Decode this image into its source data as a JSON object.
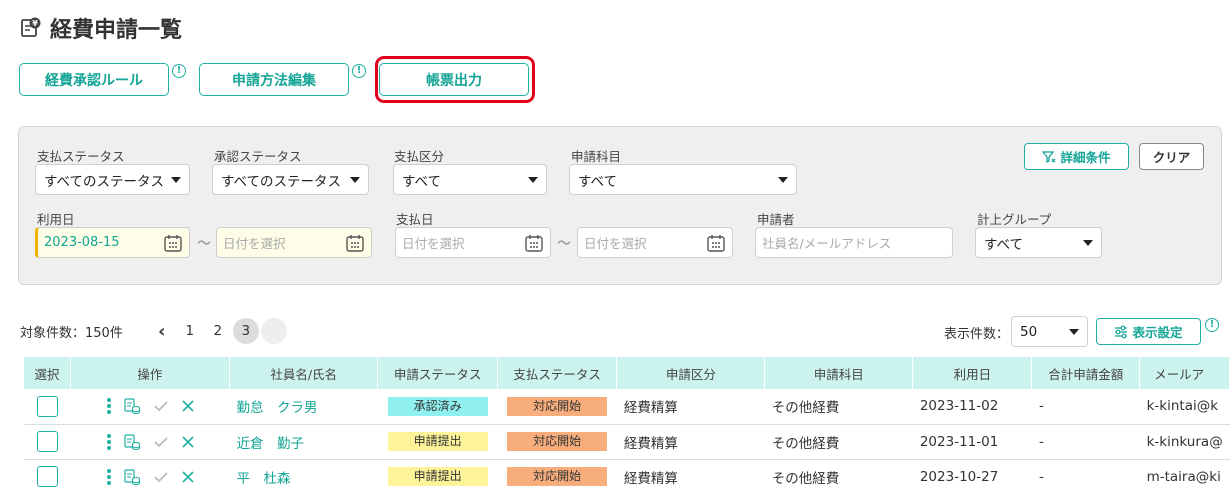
{
  "page": {
    "title": "経費申請一覧"
  },
  "toolbar": {
    "approval_rule": "経費承認ルール",
    "application_edit": "申請方法編集",
    "report_output": "帳票出力",
    "info_glyph": "!"
  },
  "filters": {
    "payment_status": {
      "label": "支払ステータス",
      "value": "すべてのステータス"
    },
    "approval_status": {
      "label": "承認ステータス",
      "value": "すべてのステータス"
    },
    "payment_type": {
      "label": "支払区分",
      "value": "すべて"
    },
    "expense_item": {
      "label": "申請科目",
      "value": "すべて"
    },
    "use_date": {
      "label": "利用日",
      "from": "2023-08-15",
      "to_placeholder": "日付を選択"
    },
    "payment_date": {
      "label": "支払日",
      "from_placeholder": "日付を選択",
      "to_placeholder": "日付を選択"
    },
    "applicant": {
      "label": "申請者",
      "placeholder": "社員名/メールアドレス"
    },
    "group": {
      "label": "計上グループ",
      "value": "すべて"
    },
    "tilde": "〜",
    "detail_button": "詳細条件",
    "clear_button": "クリア"
  },
  "pager": {
    "count_text": "対象件数：150件",
    "prev": "‹",
    "pages": [
      "1",
      "2",
      "3"
    ],
    "current": "3"
  },
  "display": {
    "count_label": "表示件数：",
    "count_value": "50",
    "settings_button": "表示設定"
  },
  "table": {
    "headers": [
      "選択",
      "操作",
      "社員名/氏名",
      "申請ステータス",
      "支払ステータス",
      "申請区分",
      "申請科目",
      "利用日",
      "合計申請金額",
      "メールア"
    ],
    "rows": [
      {
        "name": "勤怠　クラ男",
        "apply_status": "承認済み",
        "apply_color": "teal",
        "pay_status": "対応開始",
        "category": "経費精算",
        "item": "その他経費",
        "date": "2023-11-02",
        "amount": "-",
        "email": "k-kintai@k"
      },
      {
        "name": "近倉　勤子",
        "apply_status": "申請提出",
        "apply_color": "yellow",
        "pay_status": "対応開始",
        "category": "経費精算",
        "item": "その他経費",
        "date": "2023-11-01",
        "amount": "-",
        "email": "k-kinkura@"
      },
      {
        "name": "平　杜森",
        "apply_status": "申請提出",
        "apply_color": "yellow",
        "pay_status": "対応開始",
        "category": "経費精算",
        "item": "その他経費",
        "date": "2023-10-27",
        "amount": "-",
        "email": "m-taira@ki"
      }
    ]
  },
  "colors": {
    "accent": "#1fb0a3",
    "highlight": "#e0001b",
    "header_bg": "#cdf3ef"
  }
}
